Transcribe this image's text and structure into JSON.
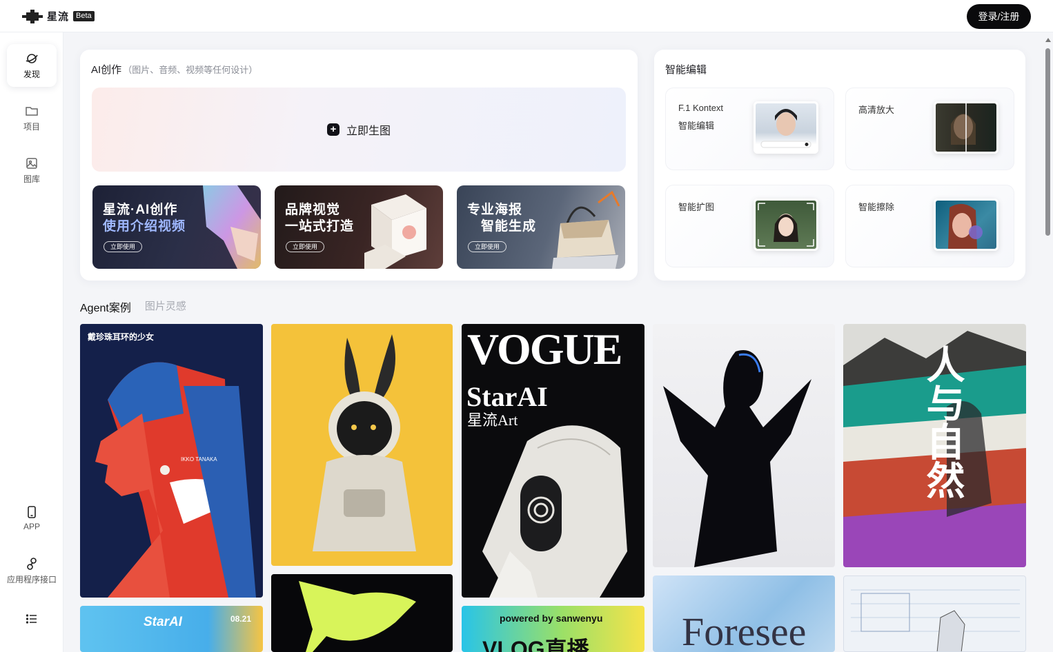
{
  "app": {
    "name": "星流",
    "badge": "Beta",
    "login_label": "登录/注册"
  },
  "sidebar": {
    "items": [
      {
        "label": "发现",
        "icon": "planet-icon"
      },
      {
        "label": "项目",
        "icon": "folder-icon"
      },
      {
        "label": "图库",
        "icon": "image-icon"
      },
      {
        "label": "APP",
        "icon": "phone-icon"
      },
      {
        "label": "应用程序接口",
        "icon": "link-icon"
      },
      {
        "label": "",
        "icon": "menu-list-icon"
      }
    ]
  },
  "ai_create": {
    "title": "AI创作",
    "subtitle": "（图片、音频、视频等任何设计）",
    "generate_label": "立即生图",
    "banners": [
      {
        "line1": "星流·AI创作",
        "line2": "使用介绍视频",
        "button": "立即使用"
      },
      {
        "line1": "品牌视觉",
        "line2": "一站式打造",
        "button": "立即使用"
      },
      {
        "line1": "专业海报",
        "line2": "智能生成",
        "button": "立即使用"
      }
    ]
  },
  "smart_edit": {
    "title": "智能编辑",
    "tools": [
      {
        "line1": "F.1 Kontext",
        "line2": "智能编辑"
      },
      {
        "line1": "高清放大",
        "line2": ""
      },
      {
        "line1": "智能扩图",
        "line2": ""
      },
      {
        "line1": "智能擦除",
        "line2": ""
      }
    ]
  },
  "gallery": {
    "tabs": [
      "Agent案例",
      "图片灵感"
    ],
    "card_texts": {
      "pearl_title": "戴珍珠耳环的少女",
      "pearl_credit": "IKKO TANAKA",
      "vogue_title": "VOGUE",
      "vogue_brand": "StarAI",
      "vogue_sub": "星流Art",
      "nature_title": "人与自然",
      "starai_logo": "StarAI",
      "starai_date": "08.21",
      "vlog_top": "powered by sanwenyu",
      "vlog_title": "VLOG直播",
      "foresee_title": "Foresee"
    }
  },
  "colors": {
    "accent": "#0a0a0c",
    "background": "#f4f5f8"
  }
}
